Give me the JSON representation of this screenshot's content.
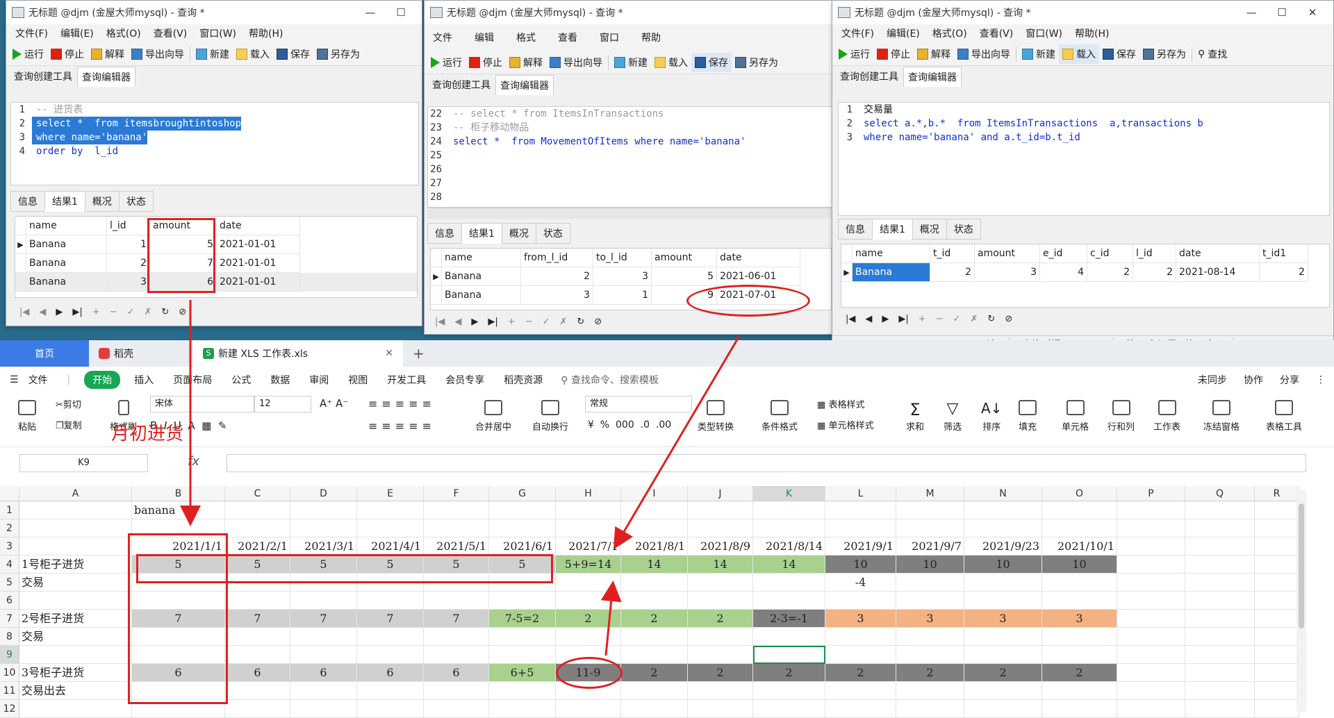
{
  "colors": {
    "selection": "#2a7ad6",
    "keyword": "#1030d0",
    "string": "#a31515",
    "annotation": "#e02020",
    "wps_home": "#3b7be5",
    "wps_start": "#18a655"
  },
  "win1": {
    "title": "无标题 @djm (金屋大师mysql) - 查询 *",
    "menu": [
      "文件(F)",
      "编辑(E)",
      "格式(O)",
      "查看(V)",
      "窗口(W)",
      "帮助(H)"
    ],
    "toolbar": [
      "运行",
      "停止",
      "解释",
      "导出向导",
      "新建",
      "载入",
      "保存",
      "另存为"
    ],
    "tabs": [
      "查询创建工具",
      "查询编辑器"
    ],
    "code": [
      {
        "ln": "1",
        "text": "-- 进货表"
      },
      {
        "ln": "2",
        "text": "select *  from itemsbroughtintoshop"
      },
      {
        "ln": "3",
        "text": "where name='banana'"
      },
      {
        "ln": "4",
        "text": "order by  l_id"
      }
    ],
    "result_tabs": [
      "信息",
      "结果1",
      "概况",
      "状态"
    ],
    "headers": [
      "name",
      "l_id",
      "amount",
      "date"
    ],
    "rows": [
      [
        "Banana",
        "1",
        "5",
        "2021-01-01"
      ],
      [
        "Banana",
        "2",
        "7",
        "2021-01-01"
      ],
      [
        "Banana",
        "3",
        "6",
        "2021-01-01"
      ]
    ]
  },
  "win2": {
    "title": "无标题 @djm (金屋大师mysql) - 查询 *",
    "menu": [
      "文件",
      "编辑",
      "格式",
      "查看",
      "窗口",
      "帮助"
    ],
    "toolbar": [
      "运行",
      "停止",
      "解释",
      "导出向导",
      "新建",
      "载入",
      "保存",
      "另存为"
    ],
    "tabs": [
      "查询创建工具",
      "查询编辑器"
    ],
    "code": [
      {
        "ln": "22",
        "text": "-- select * from ItemsInTransactions"
      },
      {
        "ln": "23",
        "text": "-- 柜子移动物品"
      },
      {
        "ln": "24",
        "text": "select *  from MovementOfItems where name='banana'"
      },
      {
        "ln": "25",
        "text": ""
      },
      {
        "ln": "26",
        "text": ""
      },
      {
        "ln": "27",
        "text": ""
      },
      {
        "ln": "28",
        "text": ""
      }
    ],
    "result_tabs": [
      "信息",
      "结果1",
      "概况",
      "状态"
    ],
    "headers": [
      "name",
      "from_l_id",
      "to_l_id",
      "amount",
      "date"
    ],
    "rows": [
      [
        "Banana",
        "2",
        "3",
        "5",
        "2021-06-01"
      ],
      [
        "Banana",
        "3",
        "1",
        "9",
        "2021-07-01"
      ]
    ]
  },
  "win3": {
    "title": "无标题 @djm (金屋大师mysql) - 查询 *",
    "menu": [
      "文件(F)",
      "编辑(E)",
      "格式(O)",
      "查看(V)",
      "窗口(W)",
      "帮助(H)"
    ],
    "toolbar": [
      "运行",
      "停止",
      "解释",
      "导出向导",
      "新建",
      "载入",
      "保存",
      "另存为",
      "查找"
    ],
    "tabs": [
      "查询创建工具",
      "查询编辑器"
    ],
    "code": [
      {
        "ln": "1",
        "text": "交易量"
      },
      {
        "ln": "2",
        "text": "select a.*,b.*  from ItemsInTransactions  a,transactions b"
      },
      {
        "ln": "3",
        "text": "where name='banana' and a.t_id=b.t_id"
      }
    ],
    "result_tabs": [
      "信息",
      "结果1",
      "概况",
      "状态"
    ],
    "headers": [
      "name",
      "t_id",
      "amount",
      "e_id",
      "c_id",
      "l_id",
      "date",
      "t_id1"
    ],
    "rows": [
      [
        "Banana",
        "2",
        "3",
        "4",
        "2",
        "2",
        "2021-08-14",
        "2"
      ]
    ],
    "status": [
      "只读",
      "查询时间: 0.002s",
      "第 1 条记录 (共 1 条)"
    ]
  },
  "wps": {
    "tabs": {
      "home": "首页",
      "daoke": "稻壳",
      "file": "新建 XLS 工作表.xls",
      "plus": "+"
    },
    "menu": [
      "文件",
      "开始",
      "插入",
      "页面布局",
      "公式",
      "数据",
      "审阅",
      "视图",
      "开发工具",
      "会员专享",
      "稻壳资源"
    ],
    "search": "查找命令、搜索模板",
    "right_menu": [
      "未同步",
      "协作",
      "分享"
    ],
    "ribbon": {
      "paste": "粘贴",
      "cut": "剪切",
      "copy": "复制",
      "format_painter": "格式刷",
      "font": "宋体",
      "font_size": "12",
      "merge": "合并居中",
      "wrap": "自动换行",
      "number_format": "常规",
      "convert": "类型转换",
      "cond_format": "条件格式",
      "table_style": "表格样式",
      "cell_style": "单元格样式",
      "sum": "求和",
      "filter": "筛选",
      "sort": "排序",
      "fill": "填充",
      "cell": "单元格",
      "rowcol": "行和列",
      "sheet": "工作表",
      "freeze": "冻结窗格",
      "tools": "表格工具"
    },
    "namebox": "K9",
    "fx": "fx",
    "columns": [
      "A",
      "B",
      "C",
      "D",
      "E",
      "F",
      "G",
      "H",
      "I",
      "J",
      "K",
      "L",
      "M",
      "N",
      "O",
      "P",
      "Q",
      "R"
    ],
    "rownums": [
      "1",
      "2",
      "3",
      "4",
      "5",
      "6",
      "7",
      "8",
      "9",
      "10",
      "11",
      "12"
    ],
    "b1": "banana",
    "dates": [
      "2021/1/1",
      "2021/2/1",
      "2021/3/1",
      "2021/4/1",
      "2021/5/1",
      "2021/6/1",
      "2021/7/1",
      "2021/8/1",
      "2021/8/9",
      "2021/8/14",
      "2021/9/1",
      "2021/9/7",
      "2021/9/23",
      "2021/10/1"
    ],
    "labels": {
      "a4": "1号柜子进货",
      "a5": "交易",
      "a7": "2号柜子进货",
      "a8": "交易",
      "a10": "3号柜子进货",
      "a11": "交易出去"
    },
    "row4": [
      "5",
      "5",
      "5",
      "5",
      "5",
      "5",
      "5+9=14",
      "14",
      "14",
      "14",
      "10",
      "10",
      "10",
      "10"
    ],
    "l5": "-4",
    "row7": [
      "7",
      "7",
      "7",
      "7",
      "7",
      "7-5=2",
      "2",
      "2",
      "2",
      "2-3=-1",
      "3",
      "3",
      "3",
      "3"
    ],
    "row10": [
      "6",
      "6",
      "6",
      "6",
      "6",
      "6+5",
      "11-9",
      "2",
      "2",
      "2",
      "2",
      "2",
      "2",
      "2"
    ]
  },
  "annotation": {
    "text": "月初进货"
  }
}
